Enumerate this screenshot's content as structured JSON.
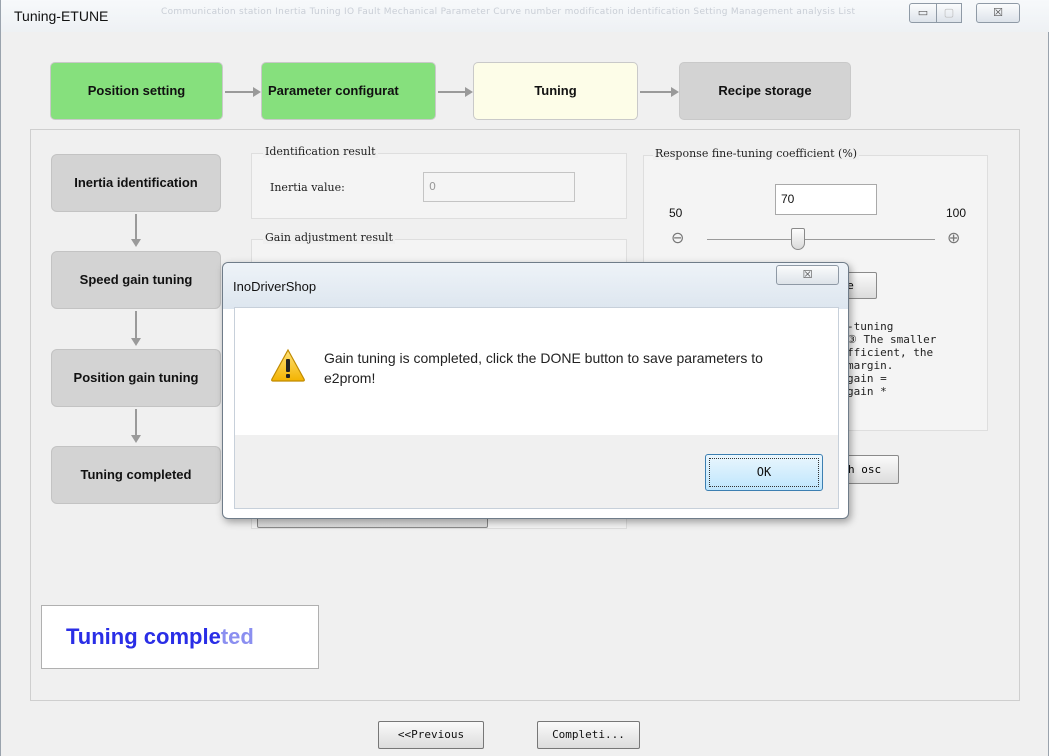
{
  "window": {
    "title": "Tuning-ETUNE",
    "background_menu_text": "Communication station   Inertia   Tuning   IO   Fault   Mechanical   Parameter   Curve   number modification   identification   Setting   Management   analysis   List",
    "controls": {
      "minimize": "▭",
      "maximize": "▢",
      "close": "☒"
    }
  },
  "steps": [
    {
      "label": "Position setting",
      "state": "done",
      "color": "#86e07d"
    },
    {
      "label": "Parameter configurat",
      "state": "done",
      "color": "#86e07d"
    },
    {
      "label": "Tuning",
      "state": "current",
      "color": "#fdfde8"
    },
    {
      "label": "Recipe storage",
      "state": "pending",
      "color": "#d3d3d3"
    }
  ],
  "left_steps": [
    {
      "label": "Inertia identification"
    },
    {
      "label": "Speed gain tuning"
    },
    {
      "label": "Position gain tuning"
    },
    {
      "label": "Tuning completed"
    }
  ],
  "identification": {
    "title": "Identification result",
    "inertia_label": "Inertia value:",
    "inertia_value": "0"
  },
  "gain_adjustment": {
    "title": "Gain adjustment result"
  },
  "response": {
    "title": "Response fine-tuning coefficient (%)",
    "value": "70",
    "min_label": "50",
    "max_label": "100",
    "slider_fraction": 0.4,
    "minus_icon": "⊖",
    "plus_icon": "⊕",
    "note_lines": [
      "-tuning",
      "③ The smaller",
      "fficient, the",
      "margin.",
      "gain =",
      "gain *"
    ],
    "partial_button": "e",
    "partial_button2": "h osc"
  },
  "dialog": {
    "title": "InoDriverShop",
    "close": "☒",
    "message": "Gain tuning is completed, click the DONE button to save parameters to e2prom!",
    "ok": "OK"
  },
  "status": {
    "text_bright": "Tuning comple",
    "text_faded": "ted",
    "color": "#2a2ee6"
  },
  "nav": {
    "previous": "<<Previous",
    "complete": "Completi..."
  }
}
